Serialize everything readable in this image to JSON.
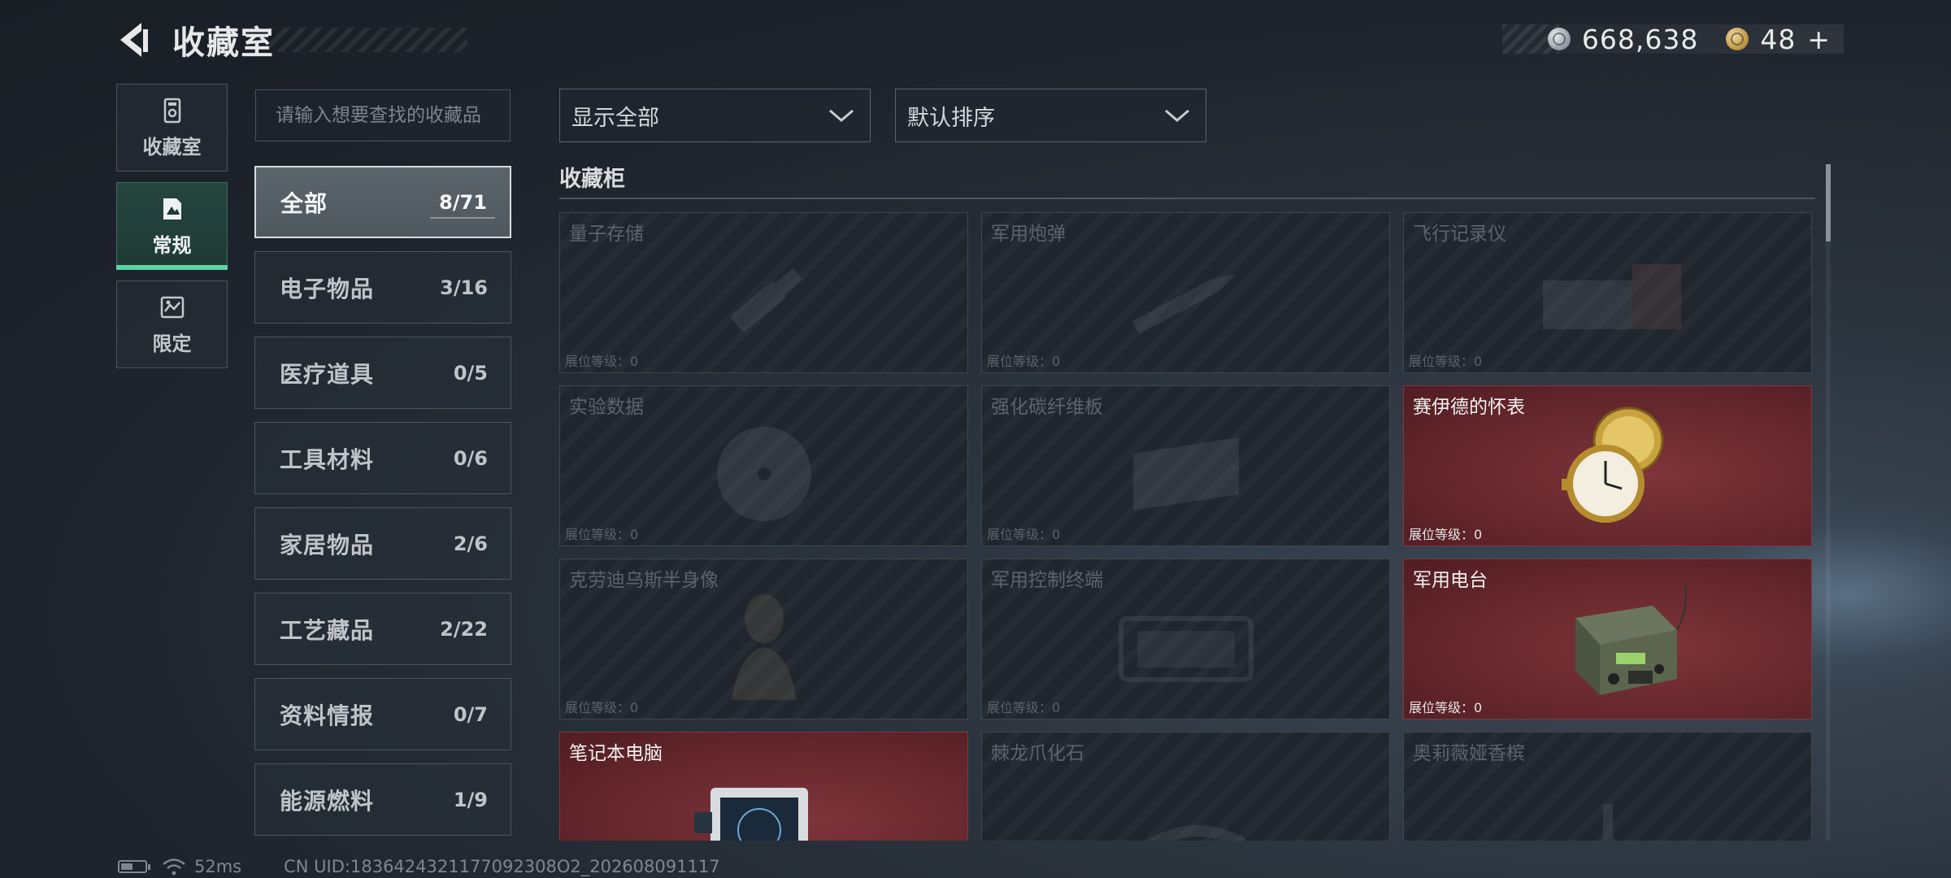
{
  "header": {
    "title": "收藏室"
  },
  "currency": [
    {
      "icon": "silver-coin-icon",
      "value": "668,638"
    },
    {
      "icon": "gold-coin-icon",
      "value": "48",
      "add": "+"
    }
  ],
  "side_nav": [
    {
      "label": "收藏室",
      "icon": "collection-room-icon"
    },
    {
      "label": "常规",
      "icon": "regular-icon",
      "active": true
    },
    {
      "label": "限定",
      "icon": "limited-icon"
    }
  ],
  "search": {
    "placeholder": "请输入想要查找的收藏品"
  },
  "categories": [
    {
      "name": "全部",
      "count": "8/71",
      "active": true
    },
    {
      "name": "电子物品",
      "count": "3/16"
    },
    {
      "name": "医疗道具",
      "count": "0/5"
    },
    {
      "name": "工具材料",
      "count": "0/6"
    },
    {
      "name": "家居物品",
      "count": "2/6"
    },
    {
      "name": "工艺藏品",
      "count": "2/22"
    },
    {
      "name": "资料情报",
      "count": "0/7"
    },
    {
      "name": "能源燃料",
      "count": "1/9"
    }
  ],
  "filters": {
    "display": "显示全部",
    "sort": "默认排序"
  },
  "section": {
    "title": "收藏柜"
  },
  "items": [
    {
      "name": "量子存储",
      "level": "展位等级：0",
      "owned": false,
      "art": "usb"
    },
    {
      "name": "军用炮弹",
      "level": "展位等级：0",
      "owned": false,
      "art": "shell"
    },
    {
      "name": "飞行记录仪",
      "level": "展位等级：0",
      "owned": false,
      "art": "recorder"
    },
    {
      "name": "实验数据",
      "level": "展位等级：0",
      "owned": false,
      "art": "disc"
    },
    {
      "name": "强化碳纤维板",
      "level": "展位等级：0",
      "owned": false,
      "art": "board"
    },
    {
      "name": "赛伊德的怀表",
      "level": "展位等级：0",
      "owned": true,
      "art": "watch"
    },
    {
      "name": "克劳迪乌斯半身像",
      "level": "展位等级：0",
      "owned": false,
      "art": "bust"
    },
    {
      "name": "军用控制终端",
      "level": "展位等级：0",
      "owned": false,
      "art": "terminal"
    },
    {
      "name": "军用电台",
      "level": "展位等级：0",
      "owned": true,
      "art": "radio"
    },
    {
      "name": "笔记本电脑",
      "level": "",
      "owned": true,
      "art": "laptop"
    },
    {
      "name": "棘龙爪化石",
      "level": "",
      "owned": false,
      "art": "claw"
    },
    {
      "name": "奥莉薇娅香槟",
      "level": "",
      "owned": false,
      "art": "bottle"
    }
  ],
  "status": {
    "ping": "52ms",
    "uid": "CN UID:1836424321177092308O2_202608091117"
  }
}
